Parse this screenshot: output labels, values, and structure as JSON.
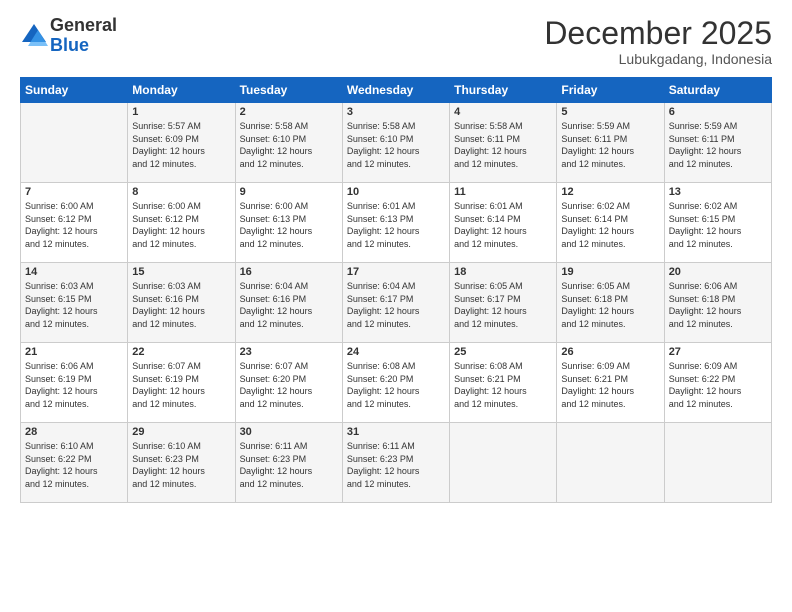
{
  "logo": {
    "general": "General",
    "blue": "Blue"
  },
  "title": "December 2025",
  "location": "Lubukgadang, Indonesia",
  "days_header": [
    "Sunday",
    "Monday",
    "Tuesday",
    "Wednesday",
    "Thursday",
    "Friday",
    "Saturday"
  ],
  "weeks": [
    [
      {
        "day": "",
        "info": ""
      },
      {
        "day": "1",
        "info": "Sunrise: 5:57 AM\nSunset: 6:09 PM\nDaylight: 12 hours\nand 12 minutes."
      },
      {
        "day": "2",
        "info": "Sunrise: 5:58 AM\nSunset: 6:10 PM\nDaylight: 12 hours\nand 12 minutes."
      },
      {
        "day": "3",
        "info": "Sunrise: 5:58 AM\nSunset: 6:10 PM\nDaylight: 12 hours\nand 12 minutes."
      },
      {
        "day": "4",
        "info": "Sunrise: 5:58 AM\nSunset: 6:11 PM\nDaylight: 12 hours\nand 12 minutes."
      },
      {
        "day": "5",
        "info": "Sunrise: 5:59 AM\nSunset: 6:11 PM\nDaylight: 12 hours\nand 12 minutes."
      },
      {
        "day": "6",
        "info": "Sunrise: 5:59 AM\nSunset: 6:11 PM\nDaylight: 12 hours\nand 12 minutes."
      }
    ],
    [
      {
        "day": "7",
        "info": "Sunrise: 6:00 AM\nSunset: 6:12 PM\nDaylight: 12 hours\nand 12 minutes."
      },
      {
        "day": "8",
        "info": "Sunrise: 6:00 AM\nSunset: 6:12 PM\nDaylight: 12 hours\nand 12 minutes."
      },
      {
        "day": "9",
        "info": "Sunrise: 6:00 AM\nSunset: 6:13 PM\nDaylight: 12 hours\nand 12 minutes."
      },
      {
        "day": "10",
        "info": "Sunrise: 6:01 AM\nSunset: 6:13 PM\nDaylight: 12 hours\nand 12 minutes."
      },
      {
        "day": "11",
        "info": "Sunrise: 6:01 AM\nSunset: 6:14 PM\nDaylight: 12 hours\nand 12 minutes."
      },
      {
        "day": "12",
        "info": "Sunrise: 6:02 AM\nSunset: 6:14 PM\nDaylight: 12 hours\nand 12 minutes."
      },
      {
        "day": "13",
        "info": "Sunrise: 6:02 AM\nSunset: 6:15 PM\nDaylight: 12 hours\nand 12 minutes."
      }
    ],
    [
      {
        "day": "14",
        "info": "Sunrise: 6:03 AM\nSunset: 6:15 PM\nDaylight: 12 hours\nand 12 minutes."
      },
      {
        "day": "15",
        "info": "Sunrise: 6:03 AM\nSunset: 6:16 PM\nDaylight: 12 hours\nand 12 minutes."
      },
      {
        "day": "16",
        "info": "Sunrise: 6:04 AM\nSunset: 6:16 PM\nDaylight: 12 hours\nand 12 minutes."
      },
      {
        "day": "17",
        "info": "Sunrise: 6:04 AM\nSunset: 6:17 PM\nDaylight: 12 hours\nand 12 minutes."
      },
      {
        "day": "18",
        "info": "Sunrise: 6:05 AM\nSunset: 6:17 PM\nDaylight: 12 hours\nand 12 minutes."
      },
      {
        "day": "19",
        "info": "Sunrise: 6:05 AM\nSunset: 6:18 PM\nDaylight: 12 hours\nand 12 minutes."
      },
      {
        "day": "20",
        "info": "Sunrise: 6:06 AM\nSunset: 6:18 PM\nDaylight: 12 hours\nand 12 minutes."
      }
    ],
    [
      {
        "day": "21",
        "info": "Sunrise: 6:06 AM\nSunset: 6:19 PM\nDaylight: 12 hours\nand 12 minutes."
      },
      {
        "day": "22",
        "info": "Sunrise: 6:07 AM\nSunset: 6:19 PM\nDaylight: 12 hours\nand 12 minutes."
      },
      {
        "day": "23",
        "info": "Sunrise: 6:07 AM\nSunset: 6:20 PM\nDaylight: 12 hours\nand 12 minutes."
      },
      {
        "day": "24",
        "info": "Sunrise: 6:08 AM\nSunset: 6:20 PM\nDaylight: 12 hours\nand 12 minutes."
      },
      {
        "day": "25",
        "info": "Sunrise: 6:08 AM\nSunset: 6:21 PM\nDaylight: 12 hours\nand 12 minutes."
      },
      {
        "day": "26",
        "info": "Sunrise: 6:09 AM\nSunset: 6:21 PM\nDaylight: 12 hours\nand 12 minutes."
      },
      {
        "day": "27",
        "info": "Sunrise: 6:09 AM\nSunset: 6:22 PM\nDaylight: 12 hours\nand 12 minutes."
      }
    ],
    [
      {
        "day": "28",
        "info": "Sunrise: 6:10 AM\nSunset: 6:22 PM\nDaylight: 12 hours\nand 12 minutes."
      },
      {
        "day": "29",
        "info": "Sunrise: 6:10 AM\nSunset: 6:23 PM\nDaylight: 12 hours\nand 12 minutes."
      },
      {
        "day": "30",
        "info": "Sunrise: 6:11 AM\nSunset: 6:23 PM\nDaylight: 12 hours\nand 12 minutes."
      },
      {
        "day": "31",
        "info": "Sunrise: 6:11 AM\nSunset: 6:23 PM\nDaylight: 12 hours\nand 12 minutes."
      },
      {
        "day": "",
        "info": ""
      },
      {
        "day": "",
        "info": ""
      },
      {
        "day": "",
        "info": ""
      }
    ]
  ]
}
